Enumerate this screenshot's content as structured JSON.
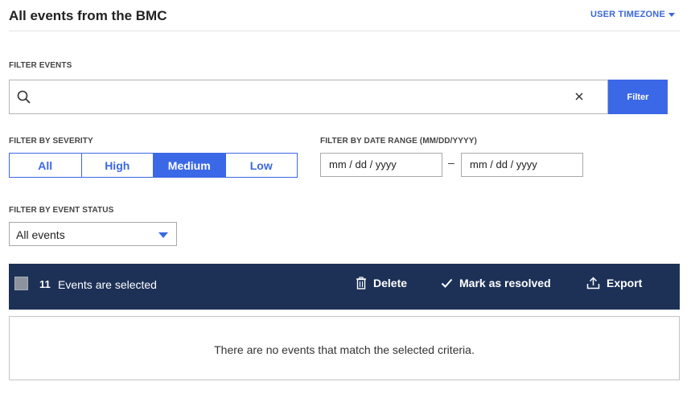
{
  "header": {
    "title": "All events from the BMC",
    "timezone_label": "USER TIMEZONE"
  },
  "filter_events": {
    "label": "FILTER EVENTS",
    "query": "",
    "placeholder": "",
    "filter_button_label": "Filter"
  },
  "severity": {
    "label": "FILTER BY SEVERITY",
    "options": [
      "All",
      "High",
      "Medium",
      "Low"
    ],
    "selected": "Medium"
  },
  "date_range": {
    "label": "FILTER BY DATE RANGE (MM/DD/YYYY)",
    "start_placeholder": "mm / dd / yyyy",
    "separator": "–",
    "end_placeholder": "mm / dd / yyyy"
  },
  "event_status": {
    "label": "FILTER BY EVENT STATUS",
    "selected": "All events"
  },
  "action_bar": {
    "selected_count": "11",
    "selected_text": "Events are selected",
    "delete_label": "Delete",
    "resolve_label": "Mark as resolved",
    "export_label": "Export"
  },
  "results": {
    "empty_message": "There are no events that match the selected criteria."
  },
  "colors": {
    "accent": "#3b68e6",
    "action_bar_bg": "#1d3157"
  },
  "icons": {
    "search": "search-icon",
    "clear": "close-icon",
    "dropdown": "caret-down-icon",
    "delete": "trash-icon",
    "resolve": "checkmark-icon",
    "export": "upload-icon"
  }
}
